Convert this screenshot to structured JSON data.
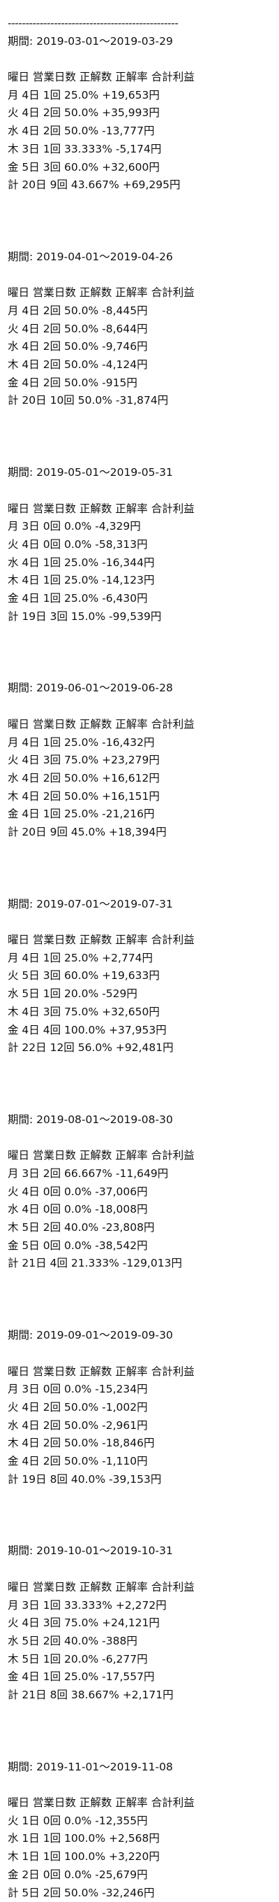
{
  "rule_text": "------------------------------------------------",
  "header": "曜日 営業日数 正解数 正解率 合計利益",
  "periods": [
    {
      "label": "期間: 2019-03-01～2019-03-29",
      "rows": [
        "月 4日 1回 25.0% +19,653円",
        "火 4日 2回 50.0% +35,993円",
        "水 4日 2回 50.0% -13,777円",
        "木 3日 1回 33.333% -5,174円",
        "金 5日 3回 60.0% +32,600円",
        "計 20日 9回 43.667% +69,295円"
      ]
    },
    {
      "label": "期間: 2019-04-01～2019-04-26",
      "rows": [
        "月 4日 2回 50.0% -8,445円",
        "火 4日 2回 50.0% -8,644円",
        "水 4日 2回 50.0% -9,746円",
        "木 4日 2回 50.0% -4,124円",
        "金 4日 2回 50.0% -915円",
        "計 20日 10回 50.0% -31,874円"
      ]
    },
    {
      "label": "期間: 2019-05-01～2019-05-31",
      "rows": [
        "月 3日 0回 0.0% -4,329円",
        "火 4日 0回 0.0% -58,313円",
        "水 4日 1回 25.0% -16,344円",
        "木 4日 1回 25.0% -14,123円",
        "金 4日 1回 25.0% -6,430円",
        "計 19日 3回 15.0% -99,539円"
      ]
    },
    {
      "label": "期間: 2019-06-01～2019-06-28",
      "rows": [
        "月 4日 1回 25.0% -16,432円",
        "火 4日 3回 75.0% +23,279円",
        "水 4日 2回 50.0% +16,612円",
        "木 4日 2回 50.0% +16,151円",
        "金 4日 1回 25.0% -21,216円",
        "計 20日 9回 45.0% +18,394円"
      ]
    },
    {
      "label": "期間: 2019-07-01～2019-07-31",
      "rows": [
        "月 4日 1回 25.0% +2,774円",
        "火 5日 3回 60.0% +19,633円",
        "水 5日 1回 20.0% -529円",
        "木 4日 3回 75.0% +32,650円",
        "金 4日 4回 100.0% +37,953円",
        "計 22日 12回 56.0% +92,481円"
      ]
    },
    {
      "label": "期間: 2019-08-01～2019-08-30",
      "rows": [
        "月 3日 2回 66.667% -11,649円",
        "火 4日 0回 0.0% -37,006円",
        "水 4日 0回 0.0% -18,008円",
        "木 5日 2回 40.0% -23,808円",
        "金 5日 0回 0.0% -38,542円",
        "計 21日 4回 21.333% -129,013円"
      ]
    },
    {
      "label": "期間: 2019-09-01～2019-09-30",
      "rows": [
        "月 3日 0回 0.0% -15,234円",
        "火 4日 2回 50.0% -1,002円",
        "水 4日 2回 50.0% -2,961円",
        "木 4日 2回 50.0% -18,846円",
        "金 4日 2回 50.0% -1,110円",
        "計 19日 8回 40.0% -39,153円"
      ]
    },
    {
      "label": "期間: 2019-10-01～2019-10-31",
      "rows": [
        "月 3日 1回 33.333% +2,272円",
        "火 4日 3回 75.0% +24,121円",
        "水 5日 2回 40.0% -388円",
        "木 5日 1回 20.0% -6,277円",
        "金 4日 1回 25.0% -17,557円",
        "計 21日 8回 38.667% +2,171円"
      ]
    },
    {
      "label": "期間: 2019-11-01～2019-11-08",
      "rows": [
        "火 1日 0回 0.0% -12,355円",
        "水 1日 1回 100.0% +2,568円",
        "木 1日 1回 100.0% +3,220円",
        "金 2日 0回 0.0% -25,679円",
        "計 5日 2回 50.0% -32,246円"
      ]
    }
  ]
}
